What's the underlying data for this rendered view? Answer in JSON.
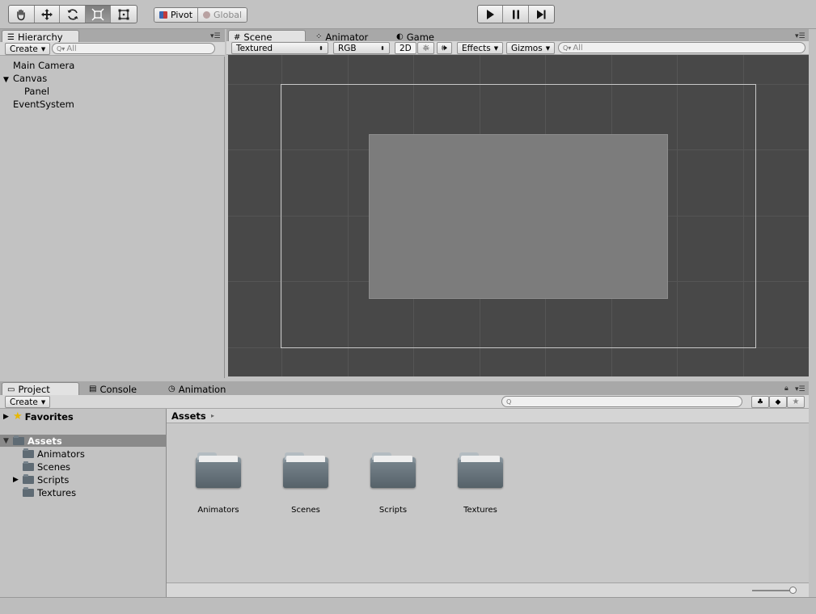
{
  "toolbar": {
    "pivot_label": "Pivot",
    "global_label": "Global"
  },
  "hierarchy": {
    "tab_label": "Hierarchy",
    "create_label": "Create",
    "search_placeholder": "All",
    "items": [
      {
        "label": "Main Camera"
      },
      {
        "label": "Canvas"
      },
      {
        "label": "Panel"
      },
      {
        "label": "EventSystem"
      }
    ]
  },
  "scene_tabs": {
    "scene": "Scene",
    "animator": "Animator",
    "game": "Game"
  },
  "scene_toolbar": {
    "render_mode": "Textured",
    "color_mode": "RGB",
    "mode_2d": "2D",
    "effects_label": "Effects",
    "gizmos_label": "Gizmos",
    "search_placeholder": "All"
  },
  "project_tabs": {
    "project": "Project",
    "console": "Console",
    "animation": "Animation"
  },
  "project": {
    "create_label": "Create",
    "favorites_label": "Favorites",
    "assets_label": "Assets",
    "breadcrumb": "Assets",
    "tree": [
      {
        "label": "Animators"
      },
      {
        "label": "Scenes"
      },
      {
        "label": "Scripts"
      },
      {
        "label": "Textures"
      }
    ],
    "folders": [
      {
        "label": "Animators"
      },
      {
        "label": "Scenes"
      },
      {
        "label": "Scripts"
      },
      {
        "label": "Textures"
      }
    ]
  }
}
